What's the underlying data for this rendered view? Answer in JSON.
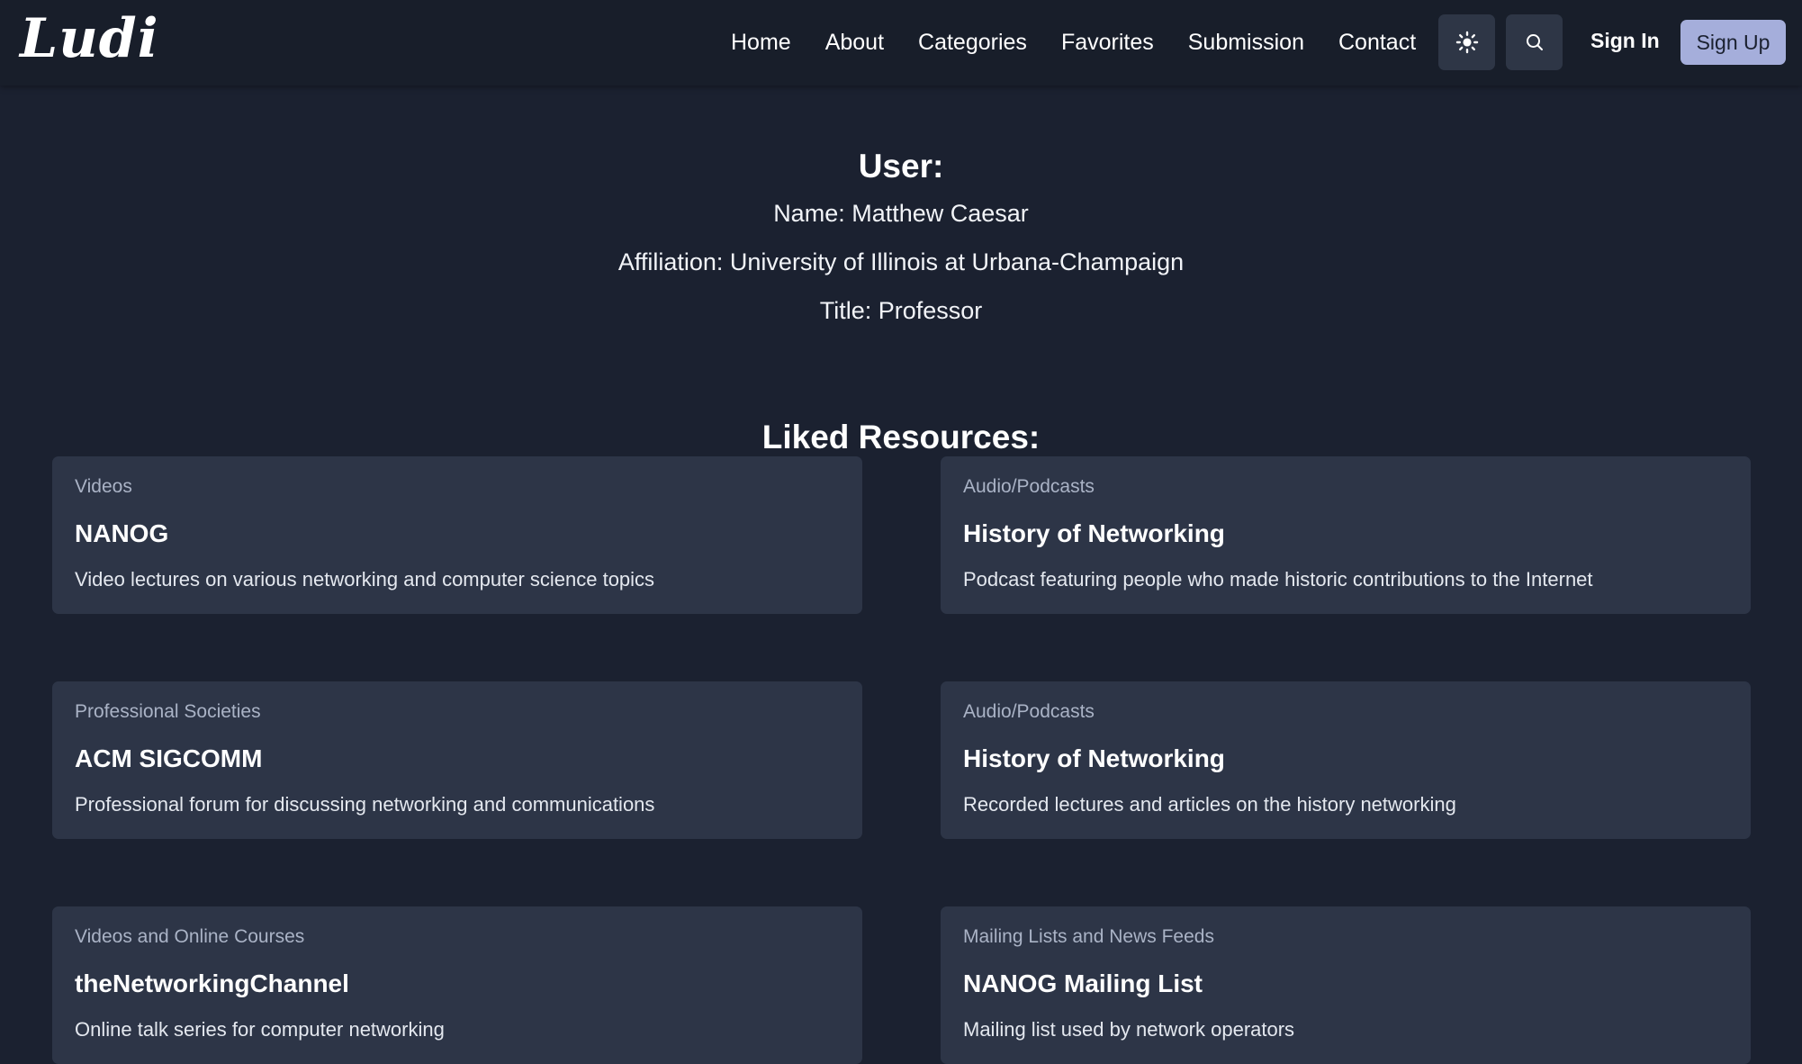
{
  "brand": {
    "logo": "Ludi"
  },
  "nav": {
    "links": [
      "Home",
      "About",
      "Categories",
      "Favorites",
      "Submission",
      "Contact"
    ],
    "theme_icon": "sun-icon",
    "search_icon": "search-icon",
    "sign_in": "Sign In",
    "sign_up": "Sign Up"
  },
  "user": {
    "heading": "User:",
    "name": "Name: Matthew Caesar",
    "affiliation": "Affiliation: University of Illinois at Urbana-Champaign",
    "title": "Title: Professor"
  },
  "liked": {
    "heading": "Liked Resources:",
    "items": [
      {
        "category": "Videos",
        "title": "NANOG",
        "description": "Video lectures on various networking and computer science topics"
      },
      {
        "category": "Audio/Podcasts",
        "title": "History of Networking",
        "description": "Podcast featuring people who made historic contributions to the Internet"
      },
      {
        "category": "Professional Societies",
        "title": "ACM SIGCOMM",
        "description": "Professional forum for discussing networking and communications"
      },
      {
        "category": "Audio/Podcasts",
        "title": "History of Networking",
        "description": "Recorded lectures and articles on the history networking"
      },
      {
        "category": "Videos and Online Courses",
        "title": "theNetworkingChannel",
        "description": "Online talk series for computer networking"
      },
      {
        "category": "Mailing Lists and News Feeds",
        "title": "NANOG Mailing List",
        "description": "Mailing list used by network operators"
      }
    ]
  },
  "colors": {
    "background": "#1b2130",
    "navbar": "#181e2a",
    "card": "#2d3547",
    "signup_button": "#a5aedb"
  }
}
